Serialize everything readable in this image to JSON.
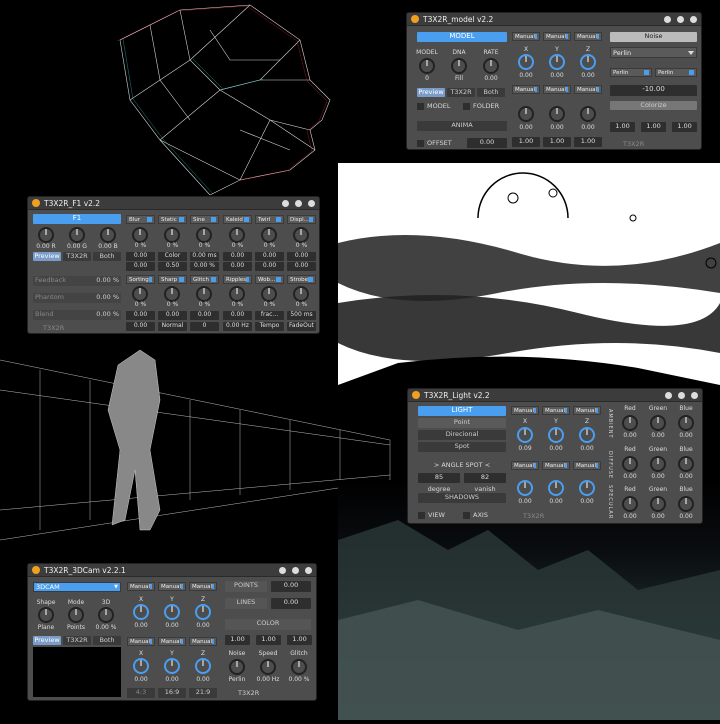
{
  "model": {
    "title": "T3X2R_model v2.2",
    "model_btn": "MODEL",
    "knobs": [
      {
        "label": "MODEL",
        "value": "0"
      },
      {
        "label": "DNA",
        "value": "Fill"
      },
      {
        "label": "RATE",
        "value": "0.00"
      }
    ],
    "tabs": [
      "Preview",
      "T3X2R",
      "Both"
    ],
    "model_chk": "MODEL",
    "folder_chk": "FOLDER",
    "anima": "ANIMA",
    "offset": "OFFSET",
    "offset_val": "0.00",
    "dd": [
      "Manual",
      "Manual",
      "Manual"
    ],
    "xyz": [
      "X",
      "Y",
      "Z"
    ],
    "row1": [
      "0.00",
      "0.00",
      "0.00"
    ],
    "row2": [
      "0.00",
      "0.00",
      "0.00"
    ],
    "row3": [
      "1.00",
      "1.00",
      "1.00"
    ],
    "noise": "Noise",
    "perlin": "Perlin",
    "perlin_a": "Perlin",
    "perlin_b": "Perlin",
    "neg_val": "-10.00",
    "colorize": "Colorize",
    "ones": [
      "1.00",
      "1.00",
      "1.00"
    ],
    "footer": "T3X2R"
  },
  "f1": {
    "title": "T3X2R_F1 v2.2",
    "f1_btn": "F1",
    "rgb": [
      "0.00 R",
      "0.00 G",
      "0.00 B"
    ],
    "tabs": [
      "Preview",
      "T3X2R",
      "Both"
    ],
    "pcts": [
      {
        "label": "Feedback",
        "value": "0.00 %"
      },
      {
        "label": "Phantom",
        "value": "0.00 %"
      },
      {
        "label": "Blend",
        "value": "0.00 %"
      }
    ],
    "top_dd": [
      "Blur",
      "Static",
      "Sine",
      "Kaleid",
      "Twirl",
      "Displ..."
    ],
    "top_val": [
      "0 %",
      "0 %",
      "0 %",
      "0 %",
      "0 %",
      "0 %"
    ],
    "mid_val": [
      "0.00",
      "Color",
      "0.00 ms",
      "0.00",
      "0.00",
      "0.00"
    ],
    "mid_val2": [
      "0.00",
      "0.50",
      "0.00 %",
      "0.00",
      "0.00",
      "0.00"
    ],
    "bot_dd": [
      "Sorting",
      "Sharp",
      "Glitch",
      "Ripples",
      "Wob...",
      "Strobe"
    ],
    "bot_val": [
      "0 %",
      "0 %",
      "0 %",
      "0 %",
      "0 %",
      "0 %"
    ],
    "bot_mid": [
      "0.00",
      "0.00",
      "0.00",
      "0.00",
      "0.00",
      "500 ms"
    ],
    "bot_last": [
      "0.00",
      "Normal",
      "0",
      "0.00 Hz",
      "Tempo",
      "FadeOut"
    ],
    "frac": "frac...",
    "footer": "T3X2R"
  },
  "light": {
    "title": "T3X2R_Light v2.2",
    "light_btn": "LIGHT",
    "modes": [
      "Point",
      "Direcional",
      "Spot"
    ],
    "angle": "> ANGLE SPOT <",
    "deg_val": "85",
    "van_val": "82",
    "deg_lbl": "degree",
    "van_lbl": "vanish",
    "shadows": "SHADOWS",
    "view": "VIEW",
    "axis": "AXIS",
    "dd": [
      "Manual",
      "Manual",
      "Manual"
    ],
    "xyz": [
      "X",
      "Y",
      "Z"
    ],
    "row1": [
      "0.09",
      "0.00",
      "0.00"
    ],
    "row2": [
      "0.00",
      "0.00",
      "0.00"
    ],
    "side_labels": [
      "AMBIENT",
      "DIFFUSE",
      "SPECULAR"
    ],
    "rgb_labels": [
      "Red",
      "Green",
      "Blue"
    ],
    "rgb_vals": [
      "0.00",
      "0.00",
      "0.00"
    ],
    "footer": "T3X2R"
  },
  "cam": {
    "title": "T3X2R_3DCam v2.2.1",
    "dd_main": "3DCAM",
    "knobs": [
      {
        "label": "Shape",
        "value": "Plane"
      },
      {
        "label": "Mode",
        "value": "Points"
      },
      {
        "label": "3D",
        "value": "0.00 %"
      }
    ],
    "tabs": [
      "Preview",
      "T3X2R",
      "Both"
    ],
    "dd": [
      "Manual",
      "Manual",
      "Manual"
    ],
    "xyz": [
      "X",
      "Y",
      "Z"
    ],
    "row1": [
      "0.00",
      "0.00",
      "0.00"
    ],
    "row2": [
      "0.00",
      "0.00",
      "0.00"
    ],
    "aspects": [
      "4:3",
      "16:9",
      "21:9"
    ],
    "points": "POINTS",
    "points_val": "0.00",
    "lines": "LINES",
    "lines_val": "0.00",
    "color": "COLOR",
    "ones": [
      "1.00",
      "1.00",
      "1.00"
    ],
    "noise_lbls": [
      "Noise",
      "Speed",
      "Glitch"
    ],
    "noise_vals": [
      "Perlin",
      "0.00 Hz",
      "0.00 %"
    ],
    "footer": "T3X2R"
  }
}
